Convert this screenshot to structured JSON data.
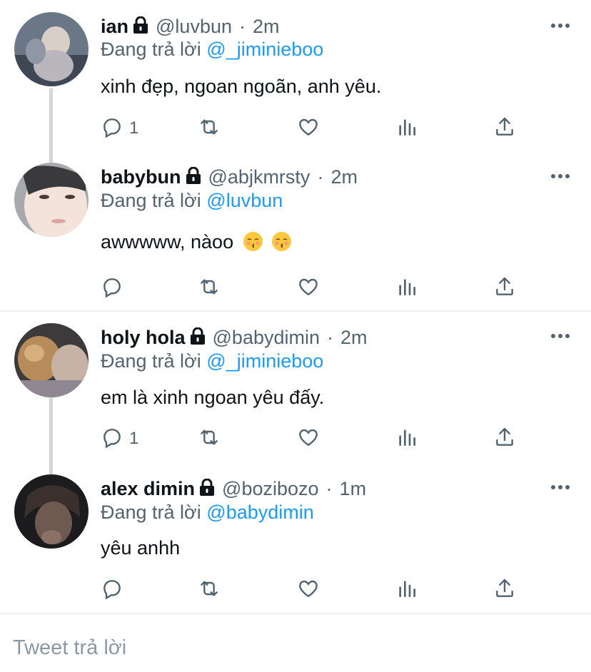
{
  "tweets": [
    {
      "name": "ian",
      "handle": "@luvbun",
      "time": "2m",
      "reply_prefix": "Đang trả lời",
      "reply_to": "@_jiminieboo",
      "text": "xinh đẹp, ngoan ngoãn, anh yêu.",
      "reply_count": "1"
    },
    {
      "name": "babybun",
      "handle": "@abjkmrsty",
      "time": "2m",
      "reply_prefix": "Đang trả lời",
      "reply_to": "@luvbun",
      "text": "awwwww, nàoo",
      "reply_count": ""
    },
    {
      "name": "holy hola",
      "handle": "@babydimin",
      "time": "2m",
      "reply_prefix": "Đang trả lời",
      "reply_to": "@_jiminieboo",
      "text": "em là xinh ngoan yêu đấy.",
      "reply_count": "1"
    },
    {
      "name": "alex dimin",
      "handle": "@bozibozo",
      "time": "1m",
      "reply_prefix": "Đang trả lời",
      "reply_to": "@babydimin",
      "text": "yêu anhh",
      "reply_count": ""
    }
  ],
  "separator": "·",
  "compose": {
    "placeholder": "Tweet trả lời"
  },
  "colors": {
    "accent": "#1d9bf0",
    "muted": "#536471",
    "divider": "#eff3f4"
  }
}
